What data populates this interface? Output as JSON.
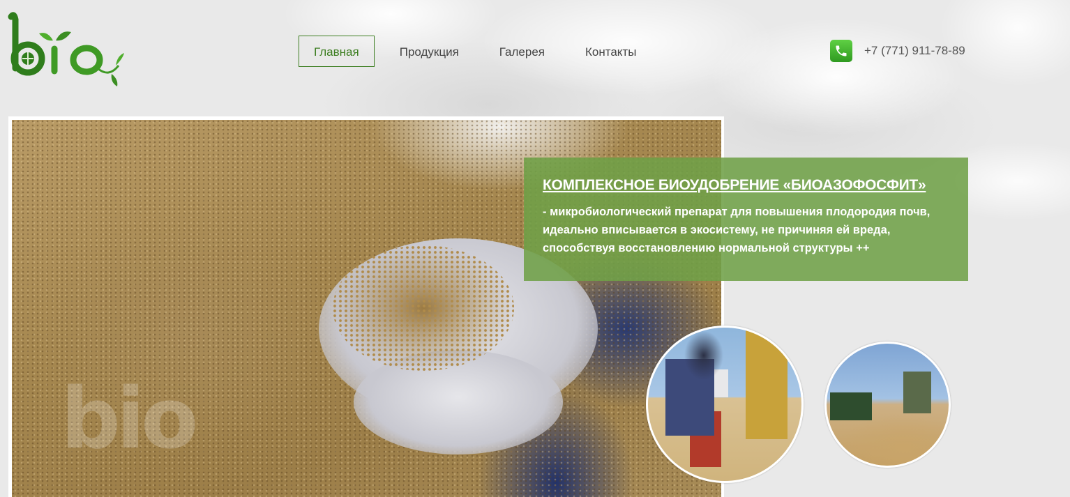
{
  "logo": {
    "text": "bio",
    "icon": "bio-leaf-logo"
  },
  "nav": {
    "items": [
      {
        "label": "Главная",
        "active": true
      },
      {
        "label": "Продукция",
        "active": false
      },
      {
        "label": "Галерея",
        "active": false
      },
      {
        "label": "Контакты",
        "active": false
      }
    ]
  },
  "contact": {
    "icon": "phone-icon",
    "phone": "+7 (771) 911-78-89"
  },
  "hero": {
    "title": "КОМПЛЕКСНОЕ БИОУДОБРЕНИЕ «БИОАЗОФОСФИТ»",
    "description": "- микробиологический препарат для повышения плодородия почв, идеально вписывается в экосистему, не причиняя ей вреда, способствуя восстановлению нормальной структуры ++"
  },
  "colors": {
    "brand_green": "#3b7d1f",
    "panel_green": "#70a048",
    "phone_green": "#3cb02a"
  }
}
